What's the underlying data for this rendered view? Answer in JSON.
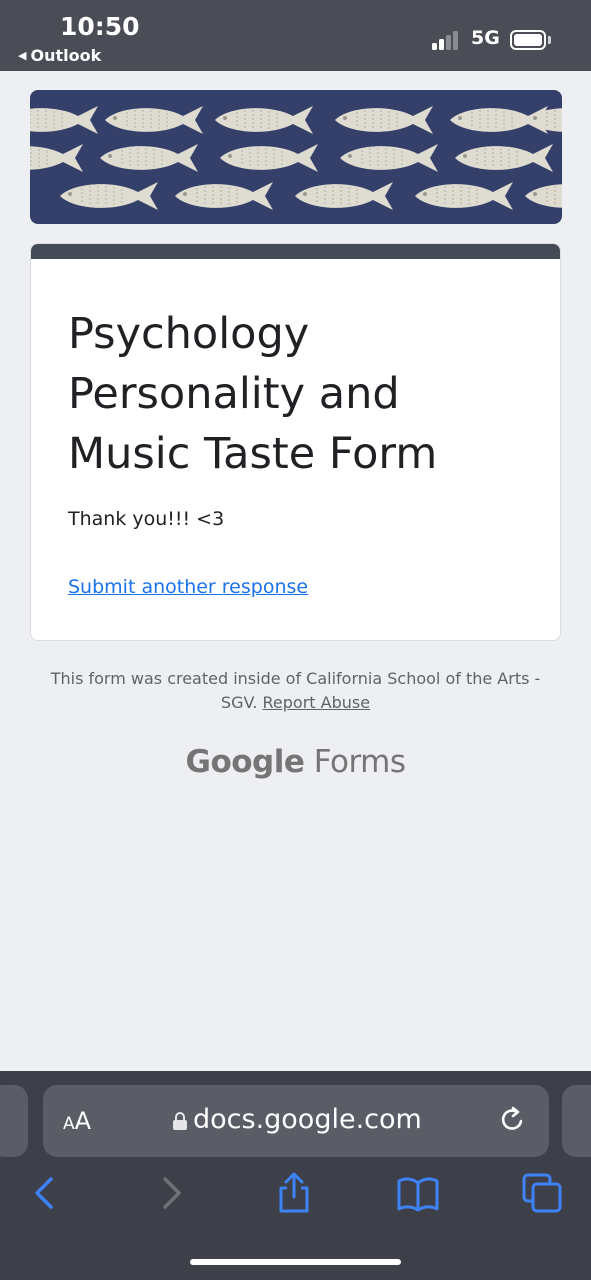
{
  "status_bar": {
    "time": "10:50",
    "back_app": "Outlook",
    "network": "5G",
    "battery_level": 1.0
  },
  "form": {
    "title": "Psychology Personality and Music Taste Form",
    "confirmation": "Thank you!!! <3",
    "submit_another": "Submit another response"
  },
  "footer": {
    "created_text": "This form was created inside of California School of the Arts - SGV.",
    "report_abuse": "Report Abuse",
    "brand_google": "Google",
    "brand_forms": "Forms"
  },
  "browser": {
    "text_size_button": "AA",
    "url": "docs.google.com"
  },
  "colors": {
    "accent": "#454a57",
    "link": "#1a73e8",
    "toolbar_icon": "#3d82f7",
    "disabled_icon": "#6f717a"
  },
  "icons": {
    "back": "chevron-left-icon",
    "forward": "chevron-right-icon",
    "share": "share-icon",
    "bookmarks": "book-icon",
    "tabs": "tabs-icon",
    "lock": "lock-icon",
    "reload": "reload-icon"
  }
}
